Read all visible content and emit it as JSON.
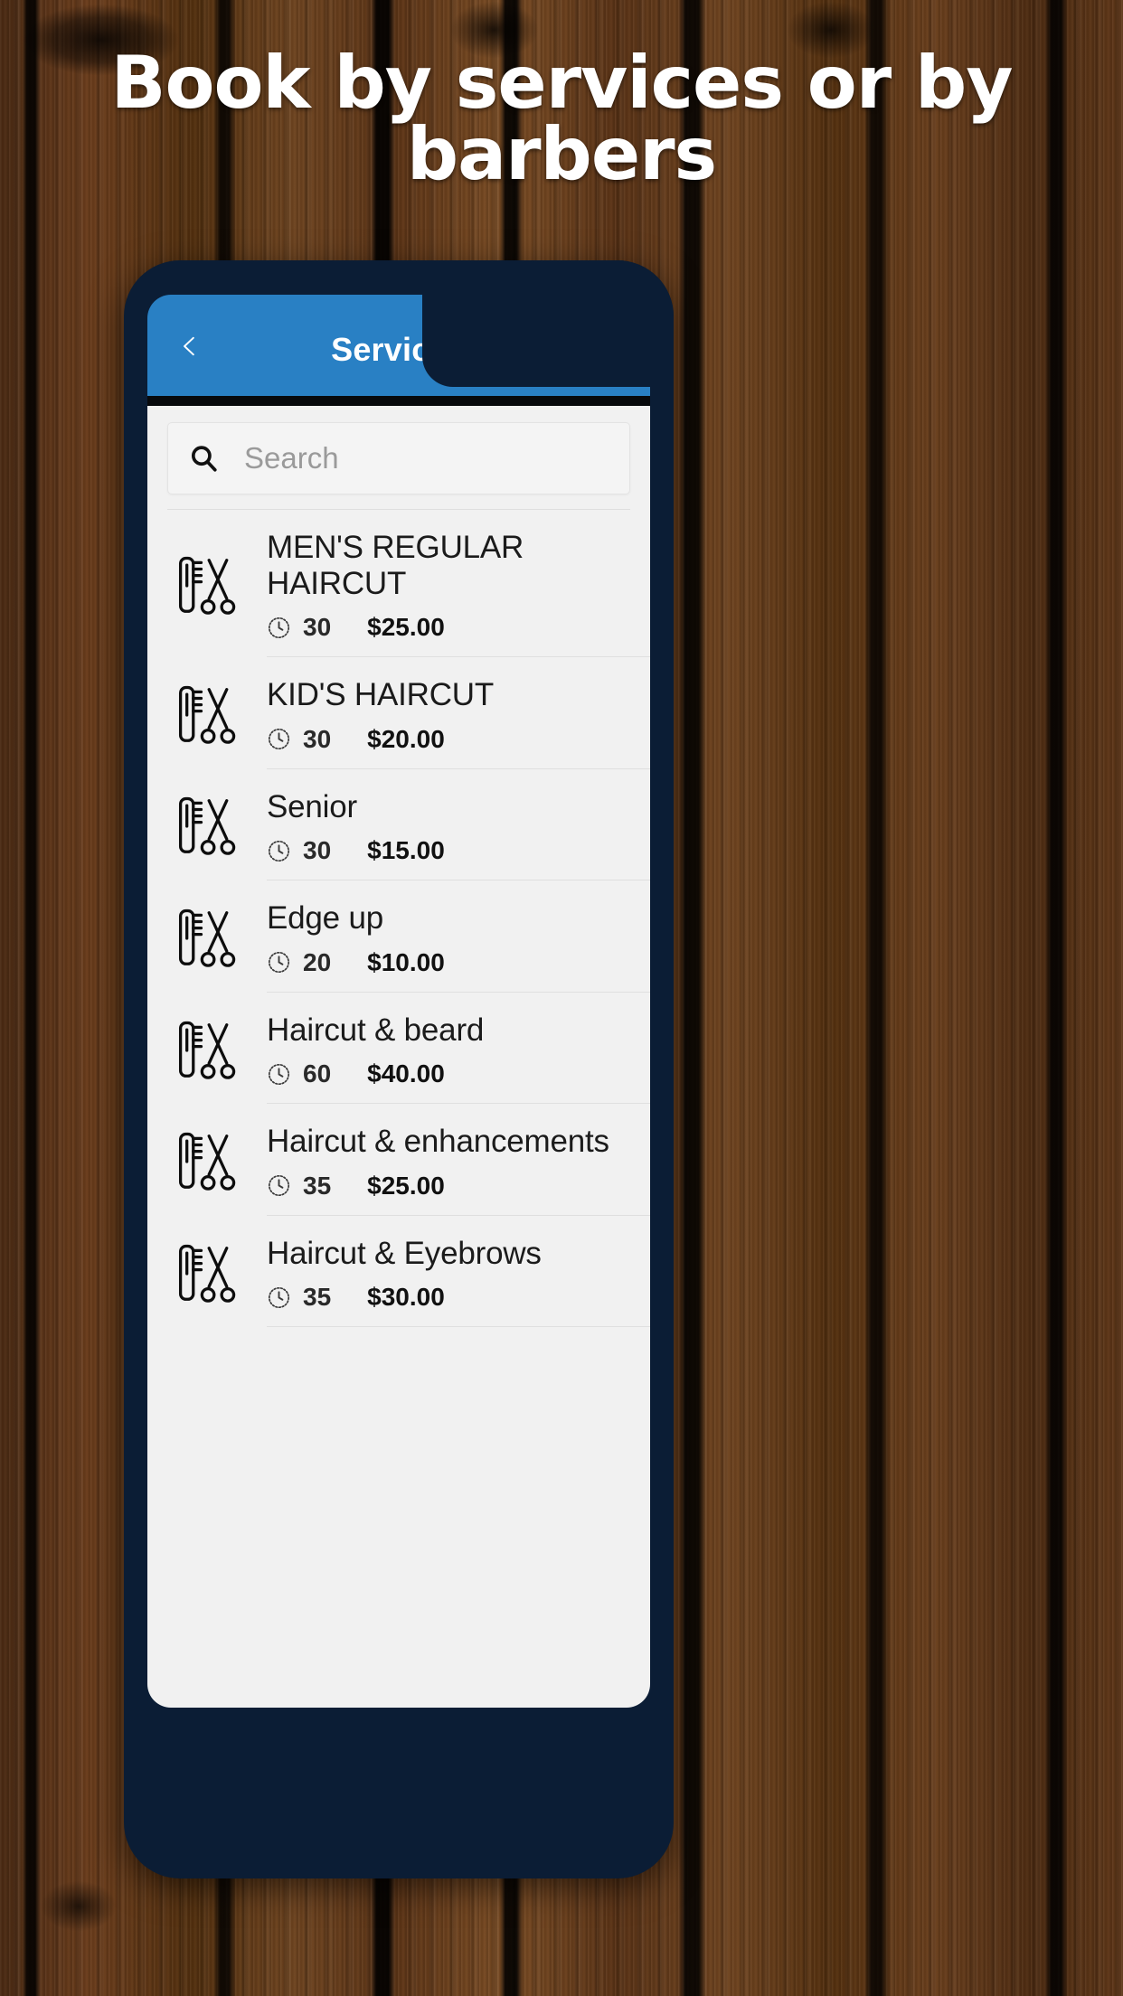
{
  "promo": {
    "headline": "Book by services or by\nbarbers"
  },
  "phone": {
    "navbar": {
      "title": "Services",
      "back_icon": "chevron-left-icon",
      "background_color": "#2980c4"
    },
    "search": {
      "icon": "search-icon",
      "placeholder": "Search",
      "value": ""
    },
    "list": {
      "item_icon": "comb-and-scissors-icon",
      "duration_icon": "clock-icon",
      "items": [
        {
          "name": "MEN'S REGULAR HAIRCUT",
          "duration": "30",
          "price": "$25.00",
          "wrap": true
        },
        {
          "name": "KID'S HAIRCUT",
          "duration": "30",
          "price": "$20.00",
          "wrap": false
        },
        {
          "name": "Senior",
          "duration": "30",
          "price": "$15.00",
          "wrap": false
        },
        {
          "name": "Edge up",
          "duration": "20",
          "price": "$10.00",
          "wrap": false
        },
        {
          "name": "Haircut & beard",
          "duration": "60",
          "price": "$40.00",
          "wrap": false
        },
        {
          "name": "Haircut & enhancements",
          "duration": "35",
          "price": "$25.00",
          "wrap": false
        },
        {
          "name": "Haircut & Eyebrows",
          "duration": "35",
          "price": "$30.00",
          "wrap": false
        }
      ]
    }
  }
}
